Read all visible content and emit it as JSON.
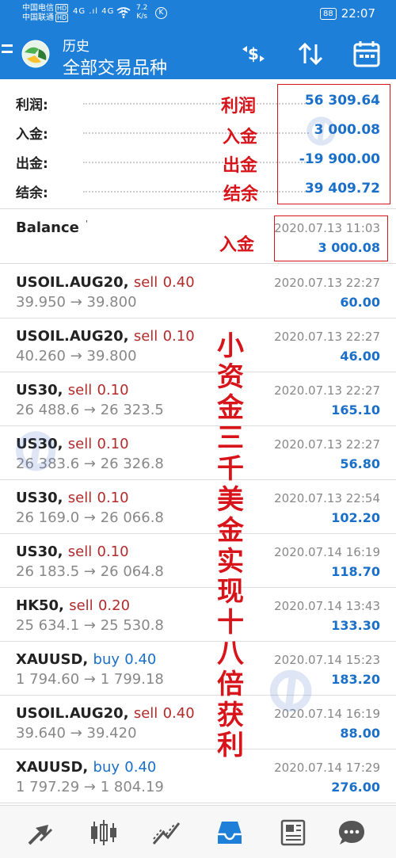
{
  "status_bar": {
    "carrier1": "中国电信",
    "carrier2": "中国联通",
    "hd": "HD",
    "signal": "4G .ıl 4G .ıl",
    "speed_value": "7.2",
    "speed_unit": "K/s",
    "k_badge": "K",
    "battery": "88",
    "time": "22:07"
  },
  "appbar": {
    "title": "历史",
    "subtitle": "全部交易品种"
  },
  "summary": [
    {
      "label": "利润:",
      "value": "56 309.64"
    },
    {
      "label": "入金:",
      "value": "3 000.08"
    },
    {
      "label": "出金:",
      "value": "-19 900.00"
    },
    {
      "label": "结余:",
      "value": "39 409.72"
    }
  ],
  "balance_row": {
    "label": "Balance",
    "mark": "'",
    "time": "2020.07.13 11:03",
    "amount": "3 000.08"
  },
  "trades": [
    {
      "symbol": "USOIL.AUG20,",
      "side": "sell",
      "volume": "0.40",
      "open": "39.950",
      "close": "39.800",
      "time": "2020.07.13 22:27",
      "profit": "60.00"
    },
    {
      "symbol": "USOIL.AUG20,",
      "side": "sell",
      "volume": "0.10",
      "open": "40.260",
      "close": "39.800",
      "time": "2020.07.13 22:27",
      "profit": "46.00"
    },
    {
      "symbol": "US30,",
      "side": "sell",
      "volume": "0.10",
      "open": "26 488.6",
      "close": "26 323.5",
      "time": "2020.07.13 22:27",
      "profit": "165.10"
    },
    {
      "symbol": "US30,",
      "side": "sell",
      "volume": "0.10",
      "open": "26 383.6",
      "close": "26 326.8",
      "time": "2020.07.13 22:27",
      "profit": "56.80"
    },
    {
      "symbol": "US30,",
      "side": "sell",
      "volume": "0.10",
      "open": "26 169.0",
      "close": "26 066.8",
      "time": "2020.07.13 22:54",
      "profit": "102.20"
    },
    {
      "symbol": "US30,",
      "side": "sell",
      "volume": "0.10",
      "open": "26 183.5",
      "close": "26 064.8",
      "time": "2020.07.14 16:19",
      "profit": "118.70"
    },
    {
      "symbol": "HK50,",
      "side": "sell",
      "volume": "0.20",
      "open": "25 634.1",
      "close": "25 530.8",
      "time": "2020.07.14 13:43",
      "profit": "133.30"
    },
    {
      "symbol": "XAUUSD,",
      "side": "buy",
      "volume": "0.40",
      "open": "1 794.60",
      "close": "1 799.18",
      "time": "2020.07.14 15:23",
      "profit": "183.20"
    },
    {
      "symbol": "USOIL.AUG20,",
      "side": "sell",
      "volume": "0.40",
      "open": "39.640",
      "close": "39.420",
      "time": "2020.07.14 16:19",
      "profit": "88.00"
    },
    {
      "symbol": "XAUUSD,",
      "side": "buy",
      "volume": "0.40",
      "open": "1 797.29",
      "close": "1 804.19",
      "time": "2020.07.14 17:29",
      "profit": "276.00"
    }
  ],
  "price_arrow": "→",
  "annotations": {
    "labels": [
      "利润",
      "入金",
      "出金",
      "结余"
    ],
    "balance_label": "入金",
    "vertical": [
      "小",
      "资",
      "金",
      "三",
      "千",
      "美",
      "金",
      "实",
      "现",
      "十",
      "八",
      "倍",
      "获",
      "利"
    ]
  },
  "colors": {
    "app_bar": "#1e7fd9",
    "value_blue": "#1a6fc9",
    "sell_red": "#b22b2b",
    "annotation_red": "#d8141b",
    "muted_gray": "#888888"
  },
  "bottom_nav": [
    {
      "name": "quotes",
      "icon": "quotes-arrows-icon"
    },
    {
      "name": "chart",
      "icon": "candlestick-icon"
    },
    {
      "name": "trade",
      "icon": "trade-line-icon"
    },
    {
      "name": "history",
      "icon": "inbox-icon",
      "active": true
    },
    {
      "name": "news",
      "icon": "newspaper-icon"
    },
    {
      "name": "messages",
      "icon": "chat-bubble-icon"
    }
  ]
}
